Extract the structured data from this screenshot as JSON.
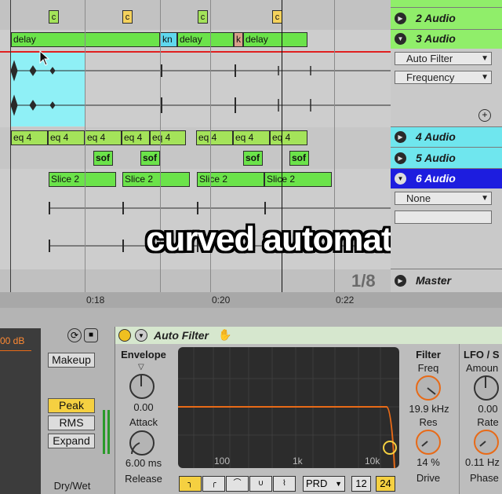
{
  "tracks": {
    "t2": {
      "name": "2 Audio"
    },
    "t3": {
      "name": "3 Audio",
      "device": "Auto Filter",
      "param": "Frequency",
      "plus": "+"
    },
    "t4": {
      "name": "4 Audio"
    },
    "t5": {
      "name": "5 Audio"
    },
    "t6": {
      "name": "6 Audio",
      "input": "None"
    },
    "master": {
      "name": "Master"
    }
  },
  "clips": {
    "c_label": "c",
    "delay": "delay",
    "kn": "kn",
    "k": "k",
    "eq4": "eq 4",
    "sof": "sof",
    "slice2": "Slice 2"
  },
  "timeline": {
    "t1": "0:18",
    "t2": "0:20",
    "t3": "0:22",
    "zoom": "1/8"
  },
  "overlay": {
    "caption": "curved automation"
  },
  "compressor": {
    "db": "00 dB",
    "makeup": "Makeup",
    "peak": "Peak",
    "rms": "RMS",
    "expand": "Expand",
    "drywet": "Dry/Wet"
  },
  "autofilter": {
    "title": "Auto Filter",
    "envelope": "Envelope",
    "env_value": "0.00",
    "attack": "Attack",
    "attack_value": "6.00 ms",
    "release": "Release",
    "freq_labels": [
      "100",
      "1k",
      "10k"
    ],
    "filter": "Filter",
    "freq": "Freq",
    "freq_value": "19.9 kHz",
    "res": "Res",
    "res_value": "14 %",
    "drive": "Drive",
    "lfo": "LFO / S",
    "amount": "Amoun",
    "amount_value": "0.00",
    "rate": "Rate",
    "rate_value": "0.11 Hz",
    "phase": "Phase",
    "prd": "PRD",
    "n12": "12",
    "n24": "24"
  },
  "colors": {
    "accent_orange": "#e86a17",
    "green_clip": "#6be34a",
    "cyan_sel": "#5fd8ee",
    "active_blue": "#1d1ddf"
  }
}
